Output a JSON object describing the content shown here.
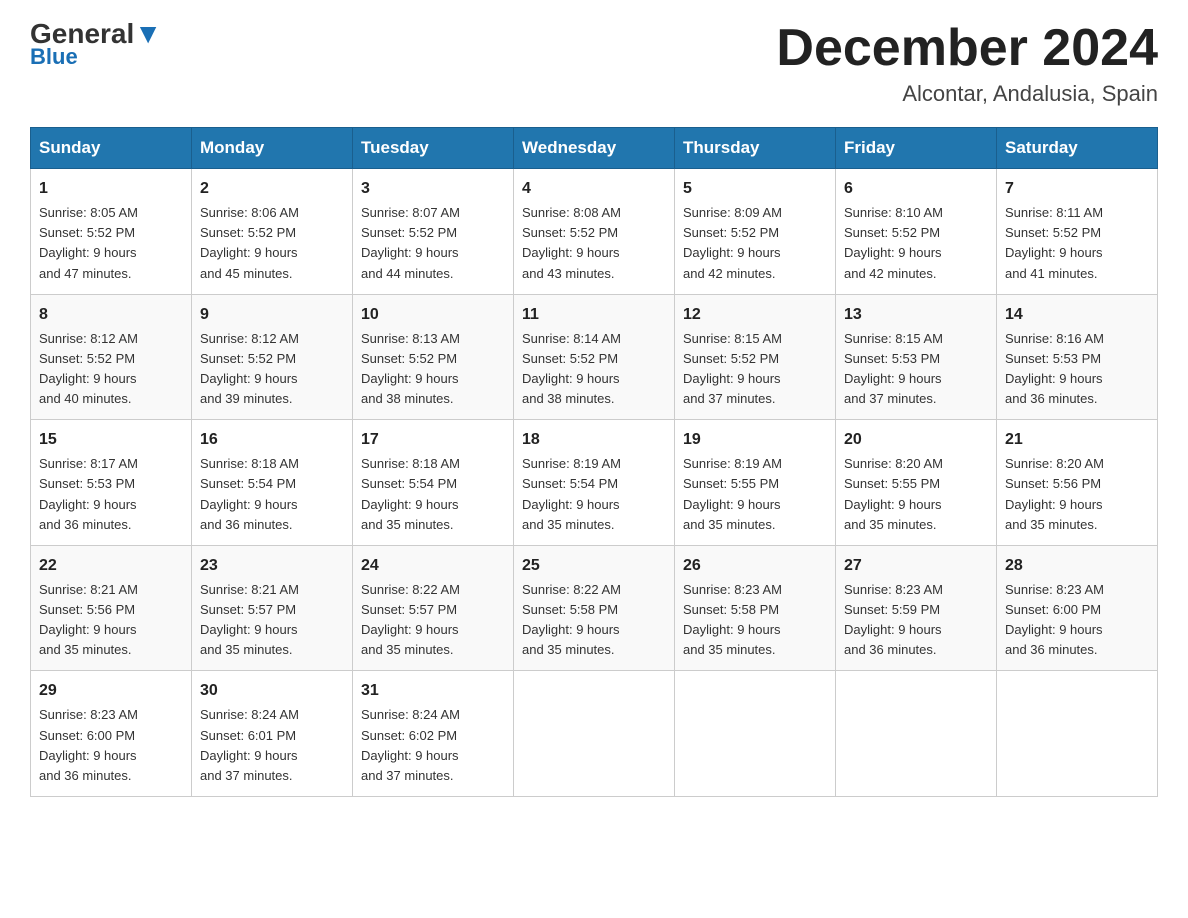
{
  "logo": {
    "general": "General",
    "blue": "Blue"
  },
  "title": "December 2024",
  "subtitle": "Alcontar, Andalusia, Spain",
  "days_of_week": [
    "Sunday",
    "Monday",
    "Tuesday",
    "Wednesday",
    "Thursday",
    "Friday",
    "Saturday"
  ],
  "weeks": [
    [
      {
        "day": "1",
        "sunrise": "8:05 AM",
        "sunset": "5:52 PM",
        "daylight": "9 hours and 47 minutes."
      },
      {
        "day": "2",
        "sunrise": "8:06 AM",
        "sunset": "5:52 PM",
        "daylight": "9 hours and 45 minutes."
      },
      {
        "day": "3",
        "sunrise": "8:07 AM",
        "sunset": "5:52 PM",
        "daylight": "9 hours and 44 minutes."
      },
      {
        "day": "4",
        "sunrise": "8:08 AM",
        "sunset": "5:52 PM",
        "daylight": "9 hours and 43 minutes."
      },
      {
        "day": "5",
        "sunrise": "8:09 AM",
        "sunset": "5:52 PM",
        "daylight": "9 hours and 42 minutes."
      },
      {
        "day": "6",
        "sunrise": "8:10 AM",
        "sunset": "5:52 PM",
        "daylight": "9 hours and 42 minutes."
      },
      {
        "day": "7",
        "sunrise": "8:11 AM",
        "sunset": "5:52 PM",
        "daylight": "9 hours and 41 minutes."
      }
    ],
    [
      {
        "day": "8",
        "sunrise": "8:12 AM",
        "sunset": "5:52 PM",
        "daylight": "9 hours and 40 minutes."
      },
      {
        "day": "9",
        "sunrise": "8:12 AM",
        "sunset": "5:52 PM",
        "daylight": "9 hours and 39 minutes."
      },
      {
        "day": "10",
        "sunrise": "8:13 AM",
        "sunset": "5:52 PM",
        "daylight": "9 hours and 38 minutes."
      },
      {
        "day": "11",
        "sunrise": "8:14 AM",
        "sunset": "5:52 PM",
        "daylight": "9 hours and 38 minutes."
      },
      {
        "day": "12",
        "sunrise": "8:15 AM",
        "sunset": "5:52 PM",
        "daylight": "9 hours and 37 minutes."
      },
      {
        "day": "13",
        "sunrise": "8:15 AM",
        "sunset": "5:53 PM",
        "daylight": "9 hours and 37 minutes."
      },
      {
        "day": "14",
        "sunrise": "8:16 AM",
        "sunset": "5:53 PM",
        "daylight": "9 hours and 36 minutes."
      }
    ],
    [
      {
        "day": "15",
        "sunrise": "8:17 AM",
        "sunset": "5:53 PM",
        "daylight": "9 hours and 36 minutes."
      },
      {
        "day": "16",
        "sunrise": "8:18 AM",
        "sunset": "5:54 PM",
        "daylight": "9 hours and 36 minutes."
      },
      {
        "day": "17",
        "sunrise": "8:18 AM",
        "sunset": "5:54 PM",
        "daylight": "9 hours and 35 minutes."
      },
      {
        "day": "18",
        "sunrise": "8:19 AM",
        "sunset": "5:54 PM",
        "daylight": "9 hours and 35 minutes."
      },
      {
        "day": "19",
        "sunrise": "8:19 AM",
        "sunset": "5:55 PM",
        "daylight": "9 hours and 35 minutes."
      },
      {
        "day": "20",
        "sunrise": "8:20 AM",
        "sunset": "5:55 PM",
        "daylight": "9 hours and 35 minutes."
      },
      {
        "day": "21",
        "sunrise": "8:20 AM",
        "sunset": "5:56 PM",
        "daylight": "9 hours and 35 minutes."
      }
    ],
    [
      {
        "day": "22",
        "sunrise": "8:21 AM",
        "sunset": "5:56 PM",
        "daylight": "9 hours and 35 minutes."
      },
      {
        "day": "23",
        "sunrise": "8:21 AM",
        "sunset": "5:57 PM",
        "daylight": "9 hours and 35 minutes."
      },
      {
        "day": "24",
        "sunrise": "8:22 AM",
        "sunset": "5:57 PM",
        "daylight": "9 hours and 35 minutes."
      },
      {
        "day": "25",
        "sunrise": "8:22 AM",
        "sunset": "5:58 PM",
        "daylight": "9 hours and 35 minutes."
      },
      {
        "day": "26",
        "sunrise": "8:23 AM",
        "sunset": "5:58 PM",
        "daylight": "9 hours and 35 minutes."
      },
      {
        "day": "27",
        "sunrise": "8:23 AM",
        "sunset": "5:59 PM",
        "daylight": "9 hours and 36 minutes."
      },
      {
        "day": "28",
        "sunrise": "8:23 AM",
        "sunset": "6:00 PM",
        "daylight": "9 hours and 36 minutes."
      }
    ],
    [
      {
        "day": "29",
        "sunrise": "8:23 AM",
        "sunset": "6:00 PM",
        "daylight": "9 hours and 36 minutes."
      },
      {
        "day": "30",
        "sunrise": "8:24 AM",
        "sunset": "6:01 PM",
        "daylight": "9 hours and 37 minutes."
      },
      {
        "day": "31",
        "sunrise": "8:24 AM",
        "sunset": "6:02 PM",
        "daylight": "9 hours and 37 minutes."
      },
      null,
      null,
      null,
      null
    ]
  ],
  "labels": {
    "sunrise": "Sunrise:",
    "sunset": "Sunset:",
    "daylight": "Daylight:"
  }
}
